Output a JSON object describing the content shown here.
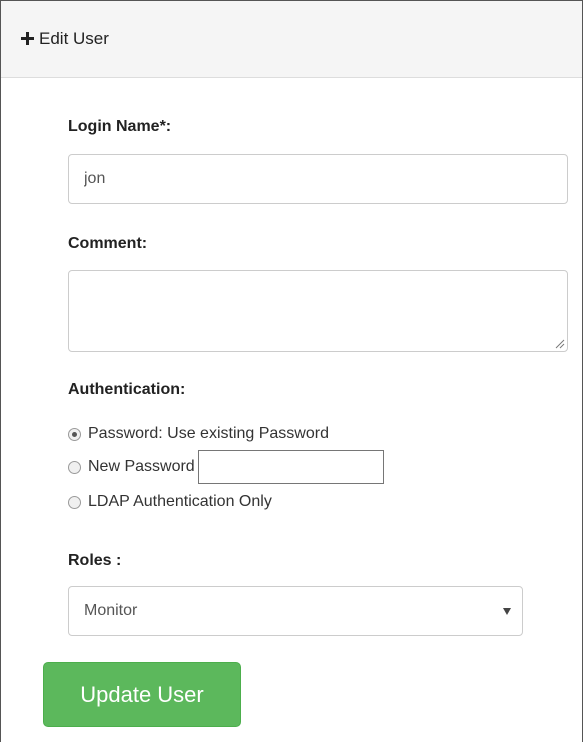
{
  "header": {
    "title": "Edit User",
    "icon": "plus-icon"
  },
  "form": {
    "login_name_label": "Login Name*:",
    "login_name_value": "jon",
    "comment_label": "Comment:",
    "comment_value": "",
    "authentication_label": "Authentication:",
    "auth_options": [
      {
        "label": "Password: Use existing Password",
        "checked": true
      },
      {
        "label": "New Password",
        "checked": false
      },
      {
        "label": "LDAP Authentication Only",
        "checked": false
      }
    ],
    "new_password_value": "",
    "roles_label": "Roles :",
    "roles_selected": "Monitor",
    "submit_label": "Update User"
  },
  "colors": {
    "header_bg": "#f5f5f5",
    "button_bg": "#5cb85c",
    "button_text": "#ffffff"
  }
}
